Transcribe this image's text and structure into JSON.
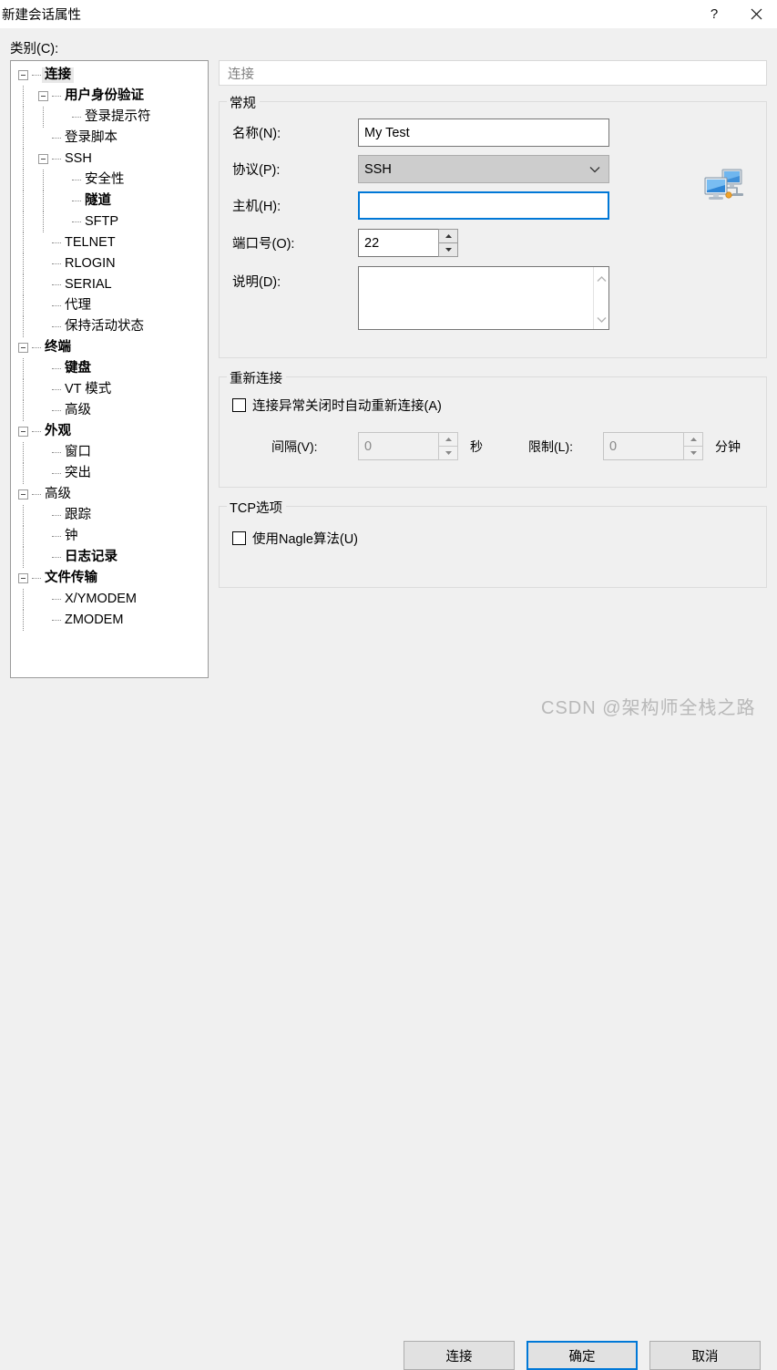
{
  "window": {
    "title": "新建会话属性",
    "help_button": "?",
    "close_button": "✕"
  },
  "category": {
    "label": "类别(C):",
    "tree": [
      {
        "label": "连接",
        "depth": 0,
        "expander": true,
        "bold": true,
        "selected": true
      },
      {
        "label": "用户身份验证",
        "depth": 1,
        "expander": true,
        "bold": true,
        "selected": false
      },
      {
        "label": "登录提示符",
        "depth": 2,
        "expander": false,
        "bold": false,
        "selected": false
      },
      {
        "label": "登录脚本",
        "depth": 1,
        "expander": false,
        "bold": false,
        "selected": false
      },
      {
        "label": "SSH",
        "depth": 1,
        "expander": true,
        "bold": false,
        "selected": false
      },
      {
        "label": "安全性",
        "depth": 2,
        "expander": false,
        "bold": false,
        "selected": false
      },
      {
        "label": "隧道",
        "depth": 2,
        "expander": false,
        "bold": true,
        "selected": false
      },
      {
        "label": "SFTP",
        "depth": 2,
        "expander": false,
        "bold": false,
        "selected": false
      },
      {
        "label": "TELNET",
        "depth": 1,
        "expander": false,
        "bold": false,
        "selected": false
      },
      {
        "label": "RLOGIN",
        "depth": 1,
        "expander": false,
        "bold": false,
        "selected": false
      },
      {
        "label": "SERIAL",
        "depth": 1,
        "expander": false,
        "bold": false,
        "selected": false
      },
      {
        "label": "代理",
        "depth": 1,
        "expander": false,
        "bold": false,
        "selected": false
      },
      {
        "label": "保持活动状态",
        "depth": 1,
        "expander": false,
        "bold": false,
        "selected": false
      },
      {
        "label": "终端",
        "depth": 0,
        "expander": true,
        "bold": true,
        "selected": false
      },
      {
        "label": "键盘",
        "depth": 1,
        "expander": false,
        "bold": true,
        "selected": false
      },
      {
        "label": "VT 模式",
        "depth": 1,
        "expander": false,
        "bold": false,
        "selected": false
      },
      {
        "label": "高级",
        "depth": 1,
        "expander": false,
        "bold": false,
        "selected": false
      },
      {
        "label": "外观",
        "depth": 0,
        "expander": true,
        "bold": true,
        "selected": false
      },
      {
        "label": "窗口",
        "depth": 1,
        "expander": false,
        "bold": false,
        "selected": false
      },
      {
        "label": "突出",
        "depth": 1,
        "expander": false,
        "bold": false,
        "selected": false
      },
      {
        "label": "高级",
        "depth": 0,
        "expander": true,
        "bold": false,
        "selected": false
      },
      {
        "label": "跟踪",
        "depth": 1,
        "expander": false,
        "bold": false,
        "selected": false
      },
      {
        "label": "钟",
        "depth": 1,
        "expander": false,
        "bold": false,
        "selected": false
      },
      {
        "label": "日志记录",
        "depth": 1,
        "expander": false,
        "bold": true,
        "selected": false
      },
      {
        "label": "文件传输",
        "depth": 0,
        "expander": true,
        "bold": true,
        "selected": false
      },
      {
        "label": "X/YMODEM",
        "depth": 1,
        "expander": false,
        "bold": false,
        "selected": false
      },
      {
        "label": "ZMODEM",
        "depth": 1,
        "expander": false,
        "bold": false,
        "selected": false
      }
    ]
  },
  "pane": {
    "header": "连接",
    "icon_name": "remote-computers-icon"
  },
  "general": {
    "title": "常规",
    "name_label": "名称(N):",
    "name_value": "My Test",
    "protocol_label": "协议(P):",
    "protocol_value": "SSH",
    "host_label": "主机(H):",
    "host_value": "",
    "host_placeholder": "",
    "port_label": "端口号(O):",
    "port_value": "22",
    "description_label": "说明(D):",
    "description_value": "",
    "description_placeholder": ""
  },
  "reconnect": {
    "title": "重新连接",
    "auto_reconnect_label": "连接异常关闭时自动重新连接(A)",
    "auto_reconnect_checked": false,
    "interval_label": "间隔(V):",
    "interval_value": "0",
    "interval_unit": "秒",
    "limit_label": "限制(L):",
    "limit_value": "0",
    "limit_unit": "分钟"
  },
  "tcp": {
    "title": "TCP选项",
    "nagle_label": "使用Nagle算法(U)",
    "nagle_checked": false
  },
  "buttons": {
    "connect": "连接",
    "ok": "确定",
    "cancel": "取消"
  },
  "watermark": "CSDN @架构师全栈之路",
  "colors": {
    "accent": "#0078d7",
    "dialog_bg": "#f0f0f0",
    "field_border": "#767676"
  }
}
